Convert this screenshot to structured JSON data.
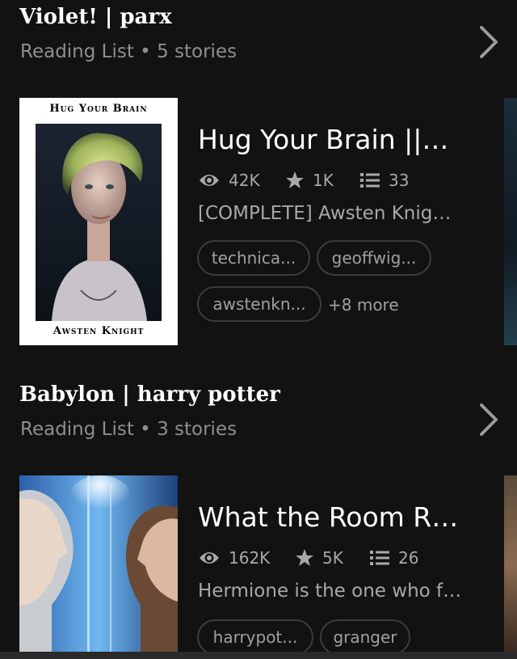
{
  "reading_lists": [
    {
      "title": "Violet! | parx",
      "subtitle": "Reading List • 5 stories",
      "story": {
        "cover_title": "Hug Your Brain",
        "cover_author": "Awsten Knight",
        "title": "Hug Your Brain ||…",
        "reads": "42K",
        "votes": "1K",
        "parts": "33",
        "description": "[COMPLETE] Awsten Knig…",
        "tags": [
          "technica...",
          "geoffwig...",
          "awstenkn..."
        ],
        "more_tags": "+8 more"
      }
    },
    {
      "title": "Babylon | harry potter",
      "subtitle": "Reading List • 3 stories",
      "story": {
        "title": "What the Room R…",
        "reads": "162K",
        "votes": "5K",
        "parts": "26",
        "description": "Hermione is the one who f…",
        "tags": [
          "harrypot...",
          "granger"
        ]
      }
    }
  ],
  "icons": {
    "chevron": "chevron-right-icon",
    "reads": "eye-icon",
    "votes": "star-icon",
    "parts": "list-icon"
  },
  "colors": {
    "background": "#121212",
    "text": "#ffffff",
    "secondary_text": "#8e8e8e",
    "tag_border": "#3c3c3c"
  }
}
